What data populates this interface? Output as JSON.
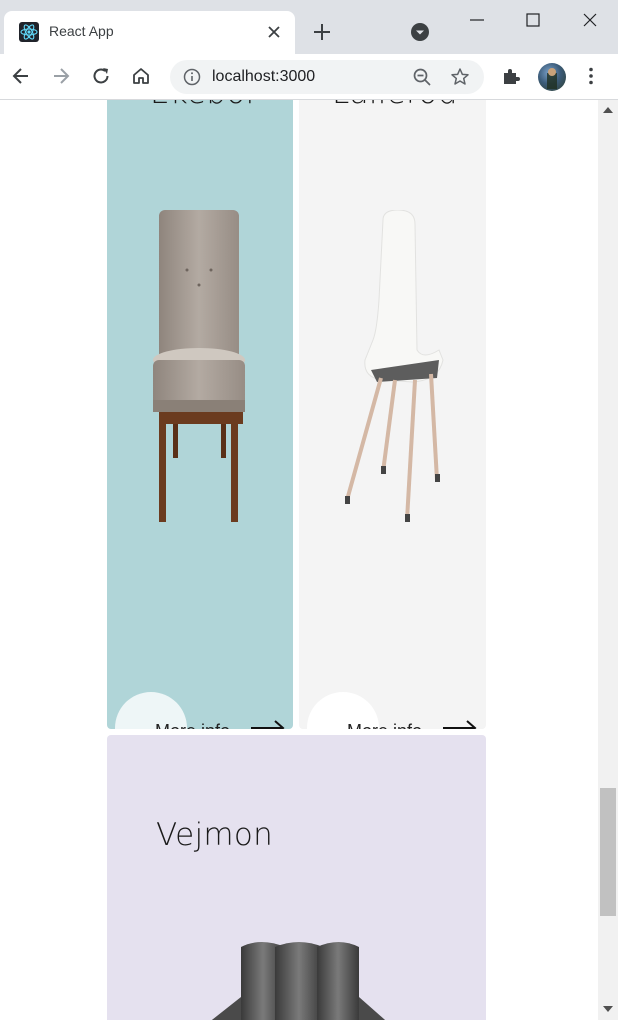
{
  "browser": {
    "tab": {
      "title": "React App",
      "favicon": "react-logo-icon"
    },
    "omnibox": {
      "url": "localhost:3000"
    },
    "icons": {
      "back": "back-arrow-icon",
      "forward": "forward-arrow-icon",
      "reload": "reload-icon",
      "home": "home-icon",
      "extensions": "puzzle-icon",
      "menu": "kebab-menu-icon"
    }
  },
  "products": [
    {
      "name": "Ekebol",
      "bg": "#b0d5d8",
      "more_label": "More info"
    },
    {
      "name": "Lallerod",
      "bg": "#f4f4f4",
      "more_label": "More info"
    },
    {
      "name": "Vejmon",
      "bg": "#e5e1ef"
    }
  ],
  "colors": {
    "text": "#1a1a1a",
    "chrome": "#dee1e6"
  }
}
